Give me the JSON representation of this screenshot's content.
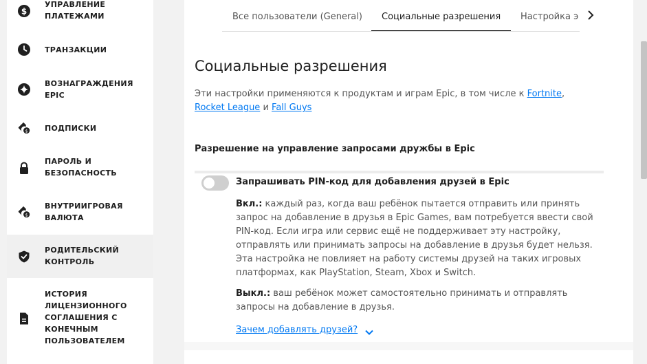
{
  "sidebar": {
    "items": [
      {
        "label": "Управление платежами",
        "icon": "dollar-icon"
      },
      {
        "label": "Транзакции",
        "icon": "clock-icon"
      },
      {
        "label": "Вознаграждения Epic",
        "icon": "star-icon"
      },
      {
        "label": "Подписки",
        "icon": "subscription-icon"
      },
      {
        "label": "Пароль и безопасность",
        "icon": "lock-icon"
      },
      {
        "label": "Внутриигровая валюта",
        "icon": "tag-icon"
      },
      {
        "label": "Родительский контроль",
        "icon": "shield-icon",
        "active": true
      },
      {
        "label": "История лицензионного соглашения с конечным пользователем",
        "icon": "document-icon"
      }
    ]
  },
  "tabs": [
    {
      "label": "Все пользователи (General)"
    },
    {
      "label": "Социальные разрешения",
      "active": true
    },
    {
      "label": "Настройка э"
    }
  ],
  "main": {
    "title": "Социальные разрешения",
    "desc_prefix": "Эти настройки применяются к продуктам и играм Epic, в том числе к ",
    "link_fortnite": "Fortnite",
    "comma": ",",
    "link_rocket": "Rocket League",
    "and": " и ",
    "link_fallguys": "Fall Guys",
    "section_heading": "Разрешение на управление запросами дружбы в Epic",
    "option_title": "Запрашивать PIN-код для добавления друзей в Epic",
    "on_label": "Вкл.:",
    "on_text": " каждый раз, когда ваш ребёнок пытается отправить или принять запрос на добавление в друзья в Epic Games, вам потребуется ввести свой PIN-код. Если игра или сервис ещё не поддерживает эту настройку, отправлять или принимать запросы на добавление в друзья будет нельзя. Эта настройка не повлияет на работу системы друзей на таких игровых платформах, как PlayStation, Steam, Xbox и Switch.",
    "off_label": "Выкл.:",
    "off_text": " ваш ребёнок может самостоятельно принимать и отправлять запросы на добавление в друзья.",
    "why_link": "Зачем добавлять друзей?",
    "toggle_on": false
  },
  "colors": {
    "accent": "#0078f2",
    "toggle_off": "#cfcfcf"
  }
}
